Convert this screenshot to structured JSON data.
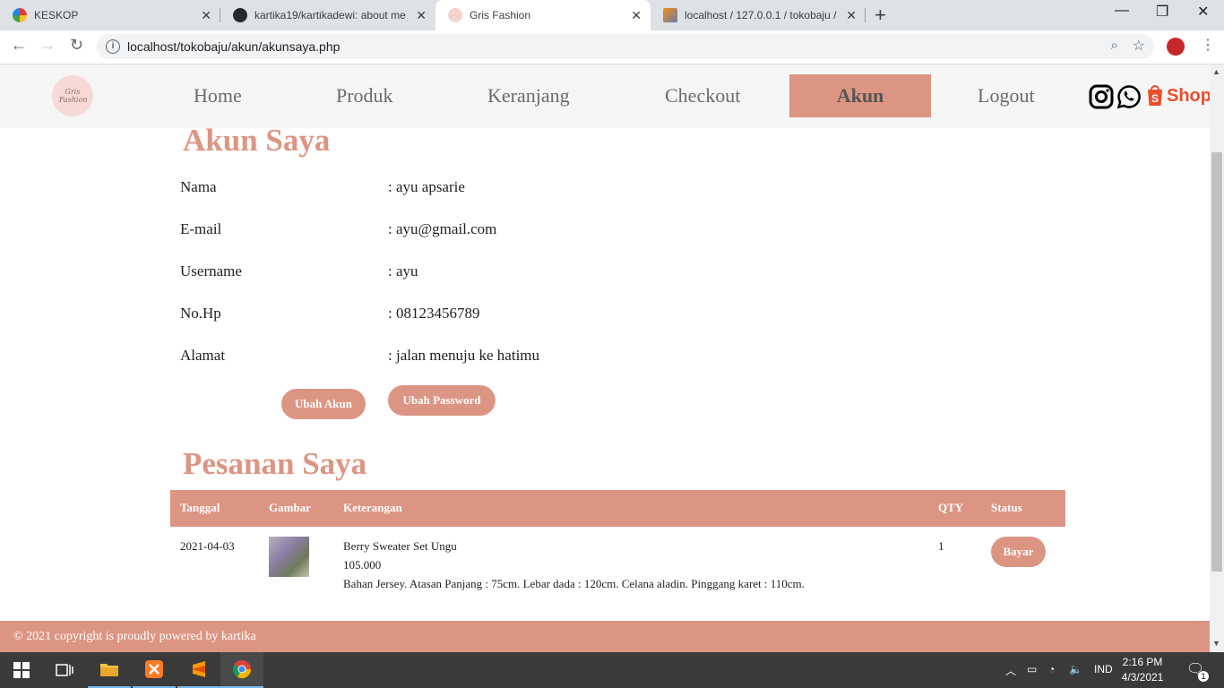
{
  "browser": {
    "tabs": [
      {
        "title": "KESKOP",
        "active": false
      },
      {
        "title": "kartika19/kartikadewi: about me",
        "active": false
      },
      {
        "title": "Gris Fashion",
        "active": true
      },
      {
        "title": "localhost / 127.0.0.1 / tokobaju / ",
        "active": false
      }
    ],
    "new_tab": "+",
    "url": "localhost/tokobaju/akun/akunsaya.php"
  },
  "site": {
    "logo_text": "Gris Fashion",
    "nav": [
      "Home",
      "Produk",
      "Keranjang",
      "Checkout",
      "Akun",
      "Logout"
    ],
    "active_nav": "Akun",
    "shopee_label": "Shope"
  },
  "account": {
    "title": "Akun Saya",
    "fields": [
      {
        "label": "Nama",
        "value": ": ayu apsarie"
      },
      {
        "label": "E-mail",
        "value": ": ayu@gmail.com"
      },
      {
        "label": "Username",
        "value": ": ayu"
      },
      {
        "label": "No.Hp",
        "value": ": 08123456789"
      },
      {
        "label": "Alamat",
        "value": ": jalan menuju ke hatimu"
      }
    ],
    "edit_account_label": "Ubah Akun",
    "change_password_label": "Ubah Password"
  },
  "orders": {
    "title": "Pesanan Saya",
    "columns": [
      "Tanggal",
      "Gambar",
      "Keterangan",
      "QTY",
      "Status"
    ],
    "rows": [
      {
        "date": "2021-04-03",
        "name": "Berry Sweater Set Ungu",
        "price": "105.000",
        "description": "Bahan Jersey. Atasan Panjang : 75cm. Lebar dada : 120cm. Celana aladin. Pinggang karet : 110cm.",
        "qty": "1",
        "status_button": "Bayar"
      }
    ]
  },
  "footer": {
    "text": "© 2021 copyright is proudly powered by kartika"
  },
  "taskbar": {
    "language": "IND",
    "time": "2:16 PM",
    "date": "4/3/2021",
    "notification_count": "1"
  },
  "colors": {
    "accent": "#dd9583",
    "header_bg": "#f6f6f6",
    "taskbar": "#3a3a3a"
  }
}
